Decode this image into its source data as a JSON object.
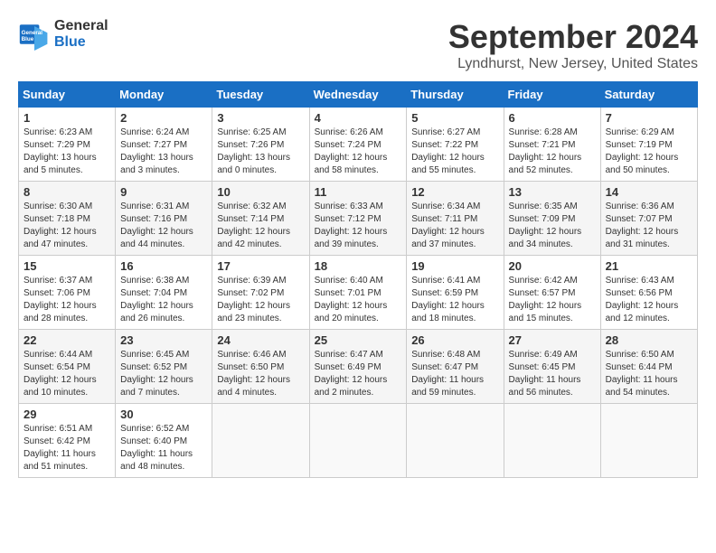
{
  "logo": {
    "line1": "General",
    "line2": "Blue"
  },
  "title": "September 2024",
  "subtitle": "Lyndhurst, New Jersey, United States",
  "header_days": [
    "Sunday",
    "Monday",
    "Tuesday",
    "Wednesday",
    "Thursday",
    "Friday",
    "Saturday"
  ],
  "weeks": [
    [
      {
        "day": "1",
        "sunrise": "6:23 AM",
        "sunset": "7:29 PM",
        "daylight": "13 hours and 5 minutes."
      },
      {
        "day": "2",
        "sunrise": "6:24 AM",
        "sunset": "7:27 PM",
        "daylight": "13 hours and 3 minutes."
      },
      {
        "day": "3",
        "sunrise": "6:25 AM",
        "sunset": "7:26 PM",
        "daylight": "13 hours and 0 minutes."
      },
      {
        "day": "4",
        "sunrise": "6:26 AM",
        "sunset": "7:24 PM",
        "daylight": "12 hours and 58 minutes."
      },
      {
        "day": "5",
        "sunrise": "6:27 AM",
        "sunset": "7:22 PM",
        "daylight": "12 hours and 55 minutes."
      },
      {
        "day": "6",
        "sunrise": "6:28 AM",
        "sunset": "7:21 PM",
        "daylight": "12 hours and 52 minutes."
      },
      {
        "day": "7",
        "sunrise": "6:29 AM",
        "sunset": "7:19 PM",
        "daylight": "12 hours and 50 minutes."
      }
    ],
    [
      {
        "day": "8",
        "sunrise": "6:30 AM",
        "sunset": "7:18 PM",
        "daylight": "12 hours and 47 minutes."
      },
      {
        "day": "9",
        "sunrise": "6:31 AM",
        "sunset": "7:16 PM",
        "daylight": "12 hours and 44 minutes."
      },
      {
        "day": "10",
        "sunrise": "6:32 AM",
        "sunset": "7:14 PM",
        "daylight": "12 hours and 42 minutes."
      },
      {
        "day": "11",
        "sunrise": "6:33 AM",
        "sunset": "7:12 PM",
        "daylight": "12 hours and 39 minutes."
      },
      {
        "day": "12",
        "sunrise": "6:34 AM",
        "sunset": "7:11 PM",
        "daylight": "12 hours and 37 minutes."
      },
      {
        "day": "13",
        "sunrise": "6:35 AM",
        "sunset": "7:09 PM",
        "daylight": "12 hours and 34 minutes."
      },
      {
        "day": "14",
        "sunrise": "6:36 AM",
        "sunset": "7:07 PM",
        "daylight": "12 hours and 31 minutes."
      }
    ],
    [
      {
        "day": "15",
        "sunrise": "6:37 AM",
        "sunset": "7:06 PM",
        "daylight": "12 hours and 28 minutes."
      },
      {
        "day": "16",
        "sunrise": "6:38 AM",
        "sunset": "7:04 PM",
        "daylight": "12 hours and 26 minutes."
      },
      {
        "day": "17",
        "sunrise": "6:39 AM",
        "sunset": "7:02 PM",
        "daylight": "12 hours and 23 minutes."
      },
      {
        "day": "18",
        "sunrise": "6:40 AM",
        "sunset": "7:01 PM",
        "daylight": "12 hours and 20 minutes."
      },
      {
        "day": "19",
        "sunrise": "6:41 AM",
        "sunset": "6:59 PM",
        "daylight": "12 hours and 18 minutes."
      },
      {
        "day": "20",
        "sunrise": "6:42 AM",
        "sunset": "6:57 PM",
        "daylight": "12 hours and 15 minutes."
      },
      {
        "day": "21",
        "sunrise": "6:43 AM",
        "sunset": "6:56 PM",
        "daylight": "12 hours and 12 minutes."
      }
    ],
    [
      {
        "day": "22",
        "sunrise": "6:44 AM",
        "sunset": "6:54 PM",
        "daylight": "12 hours and 10 minutes."
      },
      {
        "day": "23",
        "sunrise": "6:45 AM",
        "sunset": "6:52 PM",
        "daylight": "12 hours and 7 minutes."
      },
      {
        "day": "24",
        "sunrise": "6:46 AM",
        "sunset": "6:50 PM",
        "daylight": "12 hours and 4 minutes."
      },
      {
        "day": "25",
        "sunrise": "6:47 AM",
        "sunset": "6:49 PM",
        "daylight": "12 hours and 2 minutes."
      },
      {
        "day": "26",
        "sunrise": "6:48 AM",
        "sunset": "6:47 PM",
        "daylight": "11 hours and 59 minutes."
      },
      {
        "day": "27",
        "sunrise": "6:49 AM",
        "sunset": "6:45 PM",
        "daylight": "11 hours and 56 minutes."
      },
      {
        "day": "28",
        "sunrise": "6:50 AM",
        "sunset": "6:44 PM",
        "daylight": "11 hours and 54 minutes."
      }
    ],
    [
      {
        "day": "29",
        "sunrise": "6:51 AM",
        "sunset": "6:42 PM",
        "daylight": "11 hours and 51 minutes."
      },
      {
        "day": "30",
        "sunrise": "6:52 AM",
        "sunset": "6:40 PM",
        "daylight": "11 hours and 48 minutes."
      },
      null,
      null,
      null,
      null,
      null
    ]
  ]
}
